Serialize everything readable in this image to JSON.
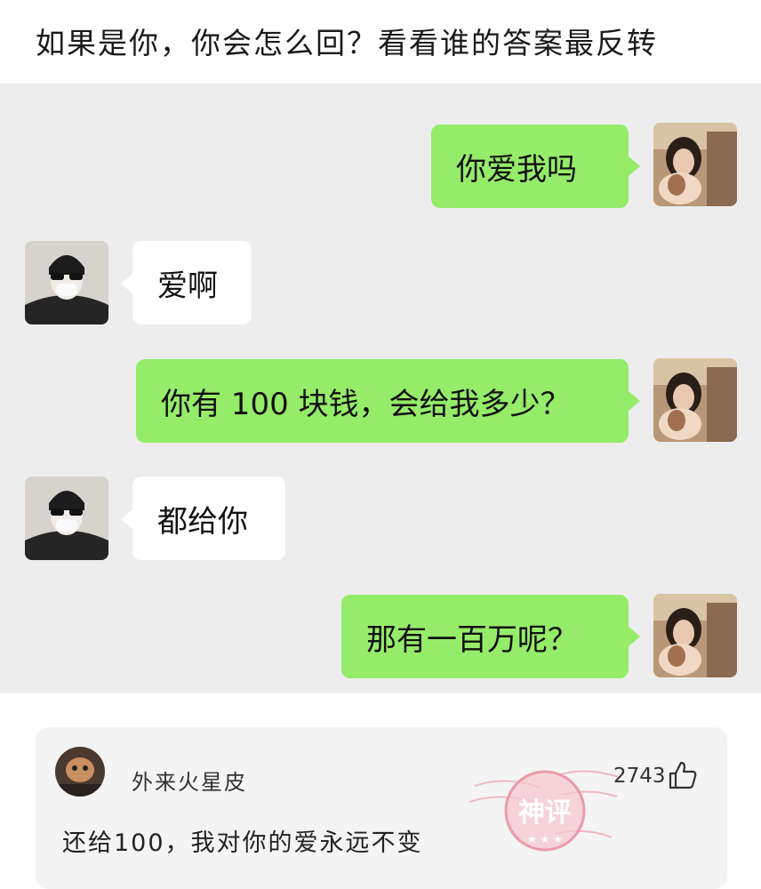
{
  "header": {
    "title": "如果是你，你会怎么回？看看谁的答案最反转"
  },
  "chat": {
    "messages": [
      {
        "side": "right",
        "text": "你爱我吗"
      },
      {
        "side": "left",
        "text": "爱啊"
      },
      {
        "side": "right",
        "text": "你有 100 块钱，会给我多少？"
      },
      {
        "side": "left",
        "text": "都给你"
      },
      {
        "side": "right",
        "text": "那有一百万呢？"
      }
    ]
  },
  "comment": {
    "username": "外来火星皮",
    "likes": "2743",
    "text": "还给100，我对你的爱永远不变",
    "badge": "神评"
  },
  "colors": {
    "chat_bg": "#ededed",
    "bubble_self": "#95ec69",
    "bubble_other": "#ffffff",
    "stamp": "#e88a9a"
  }
}
